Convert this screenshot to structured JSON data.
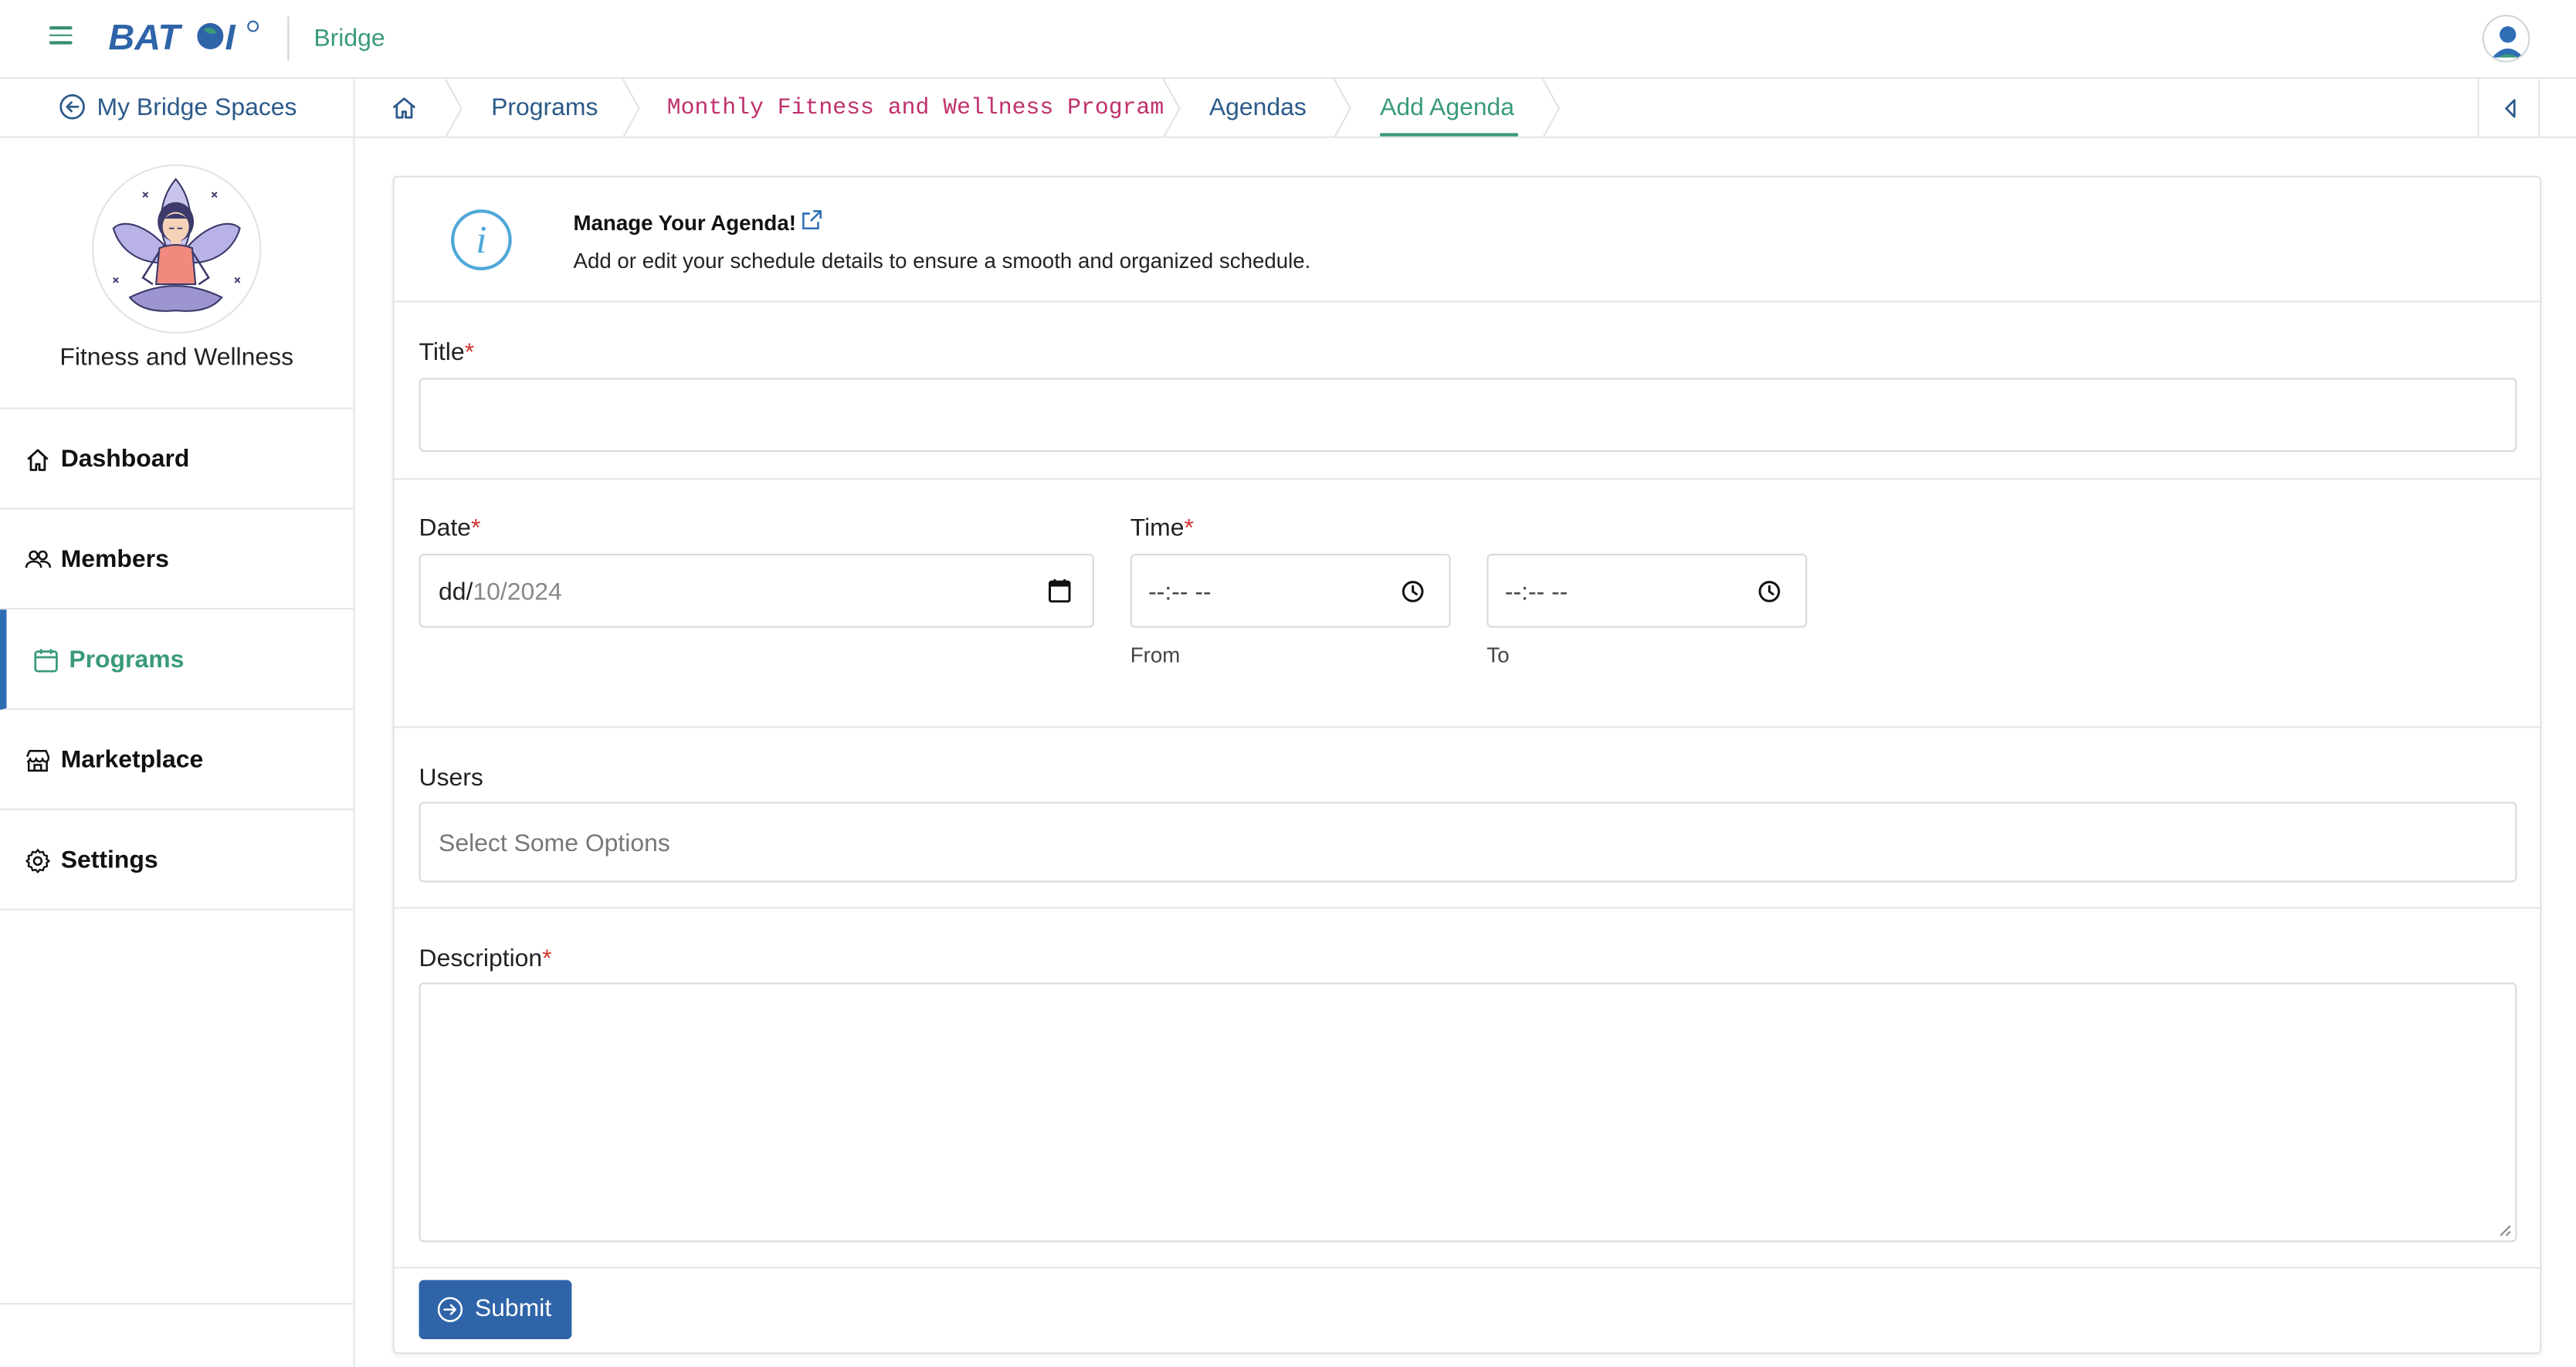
{
  "topbar": {
    "logo_text": "BATOI",
    "app_name": "Bridge"
  },
  "breadcrumbs": {
    "back_label": "My Bridge Spaces",
    "items": [
      "Programs",
      "Monthly Fitness and Wellness Program",
      "Agendas",
      "Add Agenda"
    ],
    "active_index": 3
  },
  "sidebar": {
    "space_name": "Fitness and Wellness",
    "items": [
      {
        "label": "Dashboard",
        "icon": "home-icon"
      },
      {
        "label": "Members",
        "icon": "users-icon"
      },
      {
        "label": "Programs",
        "icon": "calendar-icon",
        "active": true
      },
      {
        "label": "Marketplace",
        "icon": "store-icon"
      },
      {
        "label": "Settings",
        "icon": "gear-icon"
      }
    ]
  },
  "info": {
    "title": "Manage Your Agenda!",
    "description": "Add or edit your schedule details to ensure a smooth and organized schedule."
  },
  "form": {
    "title_label": "Title",
    "title_value": "",
    "date_label": "Date",
    "date_value_prefix": "dd/",
    "date_value_rest": "10/2024",
    "time_label": "Time",
    "time_from_value": "--:-- --",
    "time_to_value": "--:-- --",
    "from_label": "From",
    "to_label": "To",
    "users_label": "Users",
    "users_placeholder": "Select Some Options",
    "description_label": "Description",
    "description_value": "",
    "required_marker": "*",
    "submit_label": "Submit"
  },
  "colors": {
    "primary_blue": "#2f64a8",
    "brand_green": "#3a9a7b",
    "link_blue": "#2b5a8a",
    "required_red": "#d0342c",
    "code_pink": "#c0306b"
  }
}
